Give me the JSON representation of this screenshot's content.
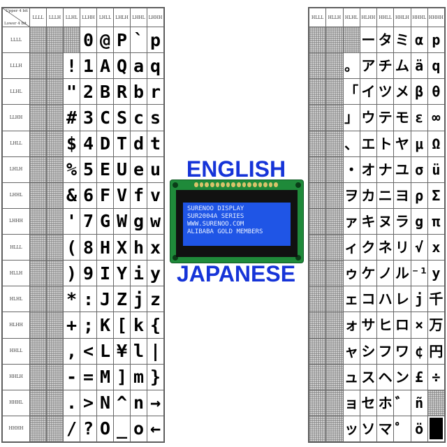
{
  "header": {
    "upper_label": "Upper 4 bit",
    "lower_label": "Lower 4 bit"
  },
  "left_table": {
    "columns": [
      "LLLL",
      "LLLH",
      "LLHL",
      "LLHH",
      "LHLL",
      "LHLH",
      "LHHL",
      "LHHH"
    ],
    "rows": [
      {
        "label": "LLLL",
        "glyphs": [
          "",
          "",
          "",
          "0",
          "@",
          "P",
          "`",
          "p"
        ]
      },
      {
        "label": "LLLH",
        "glyphs": [
          "",
          "",
          "!",
          "1",
          "A",
          "Q",
          "a",
          "q"
        ]
      },
      {
        "label": "LLHL",
        "glyphs": [
          "",
          "",
          "\"",
          "2",
          "B",
          "R",
          "b",
          "r"
        ]
      },
      {
        "label": "LLHH",
        "glyphs": [
          "",
          "",
          "#",
          "3",
          "C",
          "S",
          "c",
          "s"
        ]
      },
      {
        "label": "LHLL",
        "glyphs": [
          "",
          "",
          "$",
          "4",
          "D",
          "T",
          "d",
          "t"
        ]
      },
      {
        "label": "LHLH",
        "glyphs": [
          "",
          "",
          "%",
          "5",
          "E",
          "U",
          "e",
          "u"
        ]
      },
      {
        "label": "LHHL",
        "glyphs": [
          "",
          "",
          "&",
          "6",
          "F",
          "V",
          "f",
          "v"
        ]
      },
      {
        "label": "LHHH",
        "glyphs": [
          "",
          "",
          "'",
          "7",
          "G",
          "W",
          "g",
          "w"
        ]
      },
      {
        "label": "HLLL",
        "glyphs": [
          "",
          "",
          "(",
          "8",
          "H",
          "X",
          "h",
          "x"
        ]
      },
      {
        "label": "HLLH",
        "glyphs": [
          "",
          "",
          ")",
          "9",
          "I",
          "Y",
          "i",
          "y"
        ]
      },
      {
        "label": "HLHL",
        "glyphs": [
          "",
          "",
          "*",
          ":",
          "J",
          "Z",
          "j",
          "z"
        ]
      },
      {
        "label": "HLHH",
        "glyphs": [
          "",
          "",
          "+",
          ";",
          "K",
          "[",
          "k",
          "{"
        ]
      },
      {
        "label": "HHLL",
        "glyphs": [
          "",
          "",
          ",",
          "<",
          "L",
          "¥",
          "l",
          "|"
        ]
      },
      {
        "label": "HHLH",
        "glyphs": [
          "",
          "",
          "-",
          "=",
          "M",
          "]",
          "m",
          "}"
        ]
      },
      {
        "label": "HHHL",
        "glyphs": [
          "",
          "",
          ".",
          ">",
          "N",
          "^",
          "n",
          "→"
        ]
      },
      {
        "label": "HHHH",
        "glyphs": [
          "",
          "",
          "/",
          "?",
          "O",
          "_",
          "o",
          "←"
        ]
      }
    ]
  },
  "right_table": {
    "columns": [
      "HLLL",
      "HLLH",
      "HLHL",
      "HLHH",
      "HHLL",
      "HHLH",
      "HHHL",
      "HHHH"
    ],
    "rows": [
      {
        "glyphs": [
          "",
          "",
          "",
          "ー",
          "タ",
          "ミ",
          "α",
          "p"
        ]
      },
      {
        "glyphs": [
          "",
          "",
          "。",
          "ア",
          "チ",
          "ム",
          "ä",
          "q"
        ]
      },
      {
        "glyphs": [
          "",
          "",
          "「",
          "イ",
          "ツ",
          "メ",
          "β",
          "θ"
        ]
      },
      {
        "glyphs": [
          "",
          "",
          "」",
          "ウ",
          "テ",
          "モ",
          "ε",
          "∞"
        ]
      },
      {
        "glyphs": [
          "",
          "",
          "、",
          "エ",
          "ト",
          "ヤ",
          "μ",
          "Ω"
        ]
      },
      {
        "glyphs": [
          "",
          "",
          "・",
          "オ",
          "ナ",
          "ユ",
          "σ",
          "ü"
        ]
      },
      {
        "glyphs": [
          "",
          "",
          "ヲ",
          "カ",
          "ニ",
          "ヨ",
          "ρ",
          "Σ"
        ]
      },
      {
        "glyphs": [
          "",
          "",
          "ァ",
          "キ",
          "ヌ",
          "ラ",
          "g",
          "π"
        ]
      },
      {
        "glyphs": [
          "",
          "",
          "ィ",
          "ク",
          "ネ",
          "リ",
          "√",
          "x"
        ]
      },
      {
        "glyphs": [
          "",
          "",
          "ゥ",
          "ケ",
          "ノ",
          "ル",
          "⁻¹",
          "y"
        ]
      },
      {
        "glyphs": [
          "",
          "",
          "ェ",
          "コ",
          "ハ",
          "レ",
          "j",
          "千"
        ]
      },
      {
        "glyphs": [
          "",
          "",
          "ォ",
          "サ",
          "ヒ",
          "ロ",
          "×",
          "万"
        ]
      },
      {
        "glyphs": [
          "",
          "",
          "ャ",
          "シ",
          "フ",
          "ワ",
          "¢",
          "円"
        ]
      },
      {
        "glyphs": [
          "",
          "",
          "ュ",
          "ス",
          "ヘ",
          "ン",
          "£",
          "÷"
        ]
      },
      {
        "glyphs": [
          "",
          "",
          "ョ",
          "セ",
          "ホ",
          "゛",
          "ñ",
          ""
        ]
      },
      {
        "glyphs": [
          "",
          "",
          "ッ",
          "ソ",
          "マ",
          "゜",
          "ö",
          "█"
        ]
      }
    ]
  },
  "labels": {
    "english": "ENGLISH",
    "japanese": "JAPANESE"
  },
  "lcd": {
    "lines": [
      "SURENOO DISPLAY",
      "SUR2004A SERIES",
      "WWW.SURENOO.COM",
      "ALIBABA GOLD MEMBERS"
    ],
    "board_color": "#1f8a3a",
    "screen_color": "#1f55e6",
    "text_color": "#e8f0ff"
  },
  "colors": {
    "label": "#1634d8",
    "grid": "#7a7a7a",
    "glyph": "#000000"
  }
}
